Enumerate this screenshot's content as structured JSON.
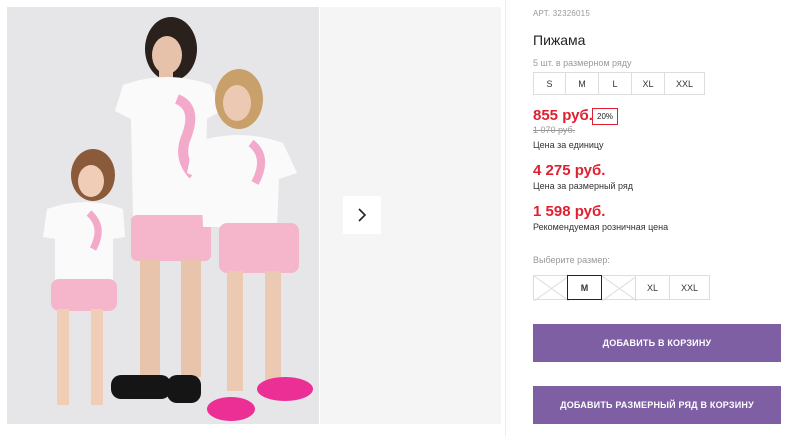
{
  "product": {
    "article_label": "АРТ.",
    "article_number": "32326015",
    "title": "Пижама",
    "pack_note": "5 шт. в размерном ряду",
    "pack_sizes": [
      "S",
      "M",
      "L",
      "XL",
      "XXL"
    ]
  },
  "pricing": {
    "unit_price": "855 руб.",
    "discount": "20%",
    "old_price": "1 070 руб.",
    "unit_note": "Цена за единицу",
    "set_price": "4 275 руб.",
    "set_note": "Цена за размерный ряд",
    "retail_price": "1 598 руб.",
    "retail_note": "Рекомендуемая розничная цена"
  },
  "size_picker": {
    "label": "Выберите размер:",
    "sizes": [
      {
        "label": "",
        "state": "unavailable"
      },
      {
        "label": "M",
        "state": "selected"
      },
      {
        "label": "",
        "state": "unavailable"
      },
      {
        "label": "XL",
        "state": "available"
      },
      {
        "label": "XXL",
        "state": "available"
      }
    ]
  },
  "actions": {
    "add_to_cart": "ДОБАВИТЬ В КОРЗИНУ",
    "add_set_to_cart": "ДОБАВИТЬ РАЗМЕРНЫЙ РЯД В КОРЗИНУ"
  },
  "gallery": {
    "next_icon": "chevron-right-icon",
    "photo_icon": "product-photo"
  },
  "colors": {
    "price_red": "#e02030",
    "button_purple": "#7e5fa4"
  }
}
